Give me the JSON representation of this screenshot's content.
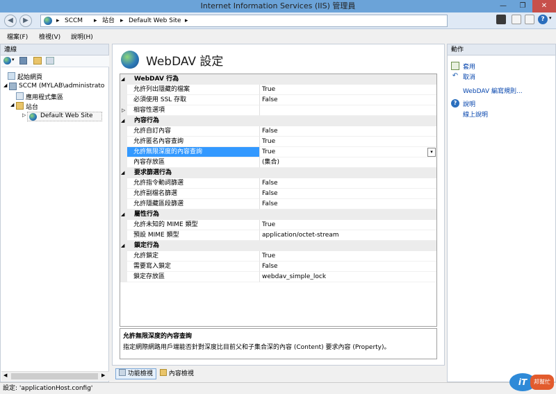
{
  "window": {
    "title": "Internet Information Services (IIS) 管理員"
  },
  "address": {
    "crumbs": [
      "SCCM",
      "站台",
      "Default Web Site"
    ]
  },
  "menu": {
    "file": "檔案(F)",
    "view": "檢視(V)",
    "help": "說明(H)"
  },
  "connections": {
    "title": "連線",
    "tree": {
      "start": "起始網頁",
      "server": "SCCM (MYLAB\\administrato",
      "app_pools": "應用程式集區",
      "sites": "站台",
      "default_site": "Default Web Site"
    }
  },
  "main": {
    "title": "WebDAV 設定",
    "categories": {
      "webdav": "WebDAV 行為",
      "content": "內容行為",
      "request": "要求篩選行為",
      "property": "屬性行為",
      "lock": "鎖定行為"
    },
    "rows": {
      "hidden_files": {
        "name": "允許列出隱藏的檔案",
        "value": "True"
      },
      "ssl": {
        "name": "必須使用 SSL 存取",
        "value": "False"
      },
      "compat": {
        "name": "相容性選項",
        "value": ""
      },
      "custom_props": {
        "name": "允許自訂內容",
        "value": "False"
      },
      "anon_query": {
        "name": "允許匿名內容查詢",
        "value": "True"
      },
      "infinite_query": {
        "name": "允許無限深度的內容查詢",
        "value": "True"
      },
      "store": {
        "name": "內容存放區",
        "value": "(集合)"
      },
      "cmd_filter": {
        "name": "允許指令動詞篩選",
        "value": "False"
      },
      "ext_filter": {
        "name": "允許副檔名篩選",
        "value": "False"
      },
      "hidden_seg": {
        "name": "允許隱藏區段篩選",
        "value": "False"
      },
      "unknown_mime": {
        "name": "允許未知的 MIME 類型",
        "value": "True"
      },
      "default_mime": {
        "name": "預設 MIME 類型",
        "value": "application/octet-stream"
      },
      "allow_lock": {
        "name": "允許鎖定",
        "value": "True"
      },
      "require_lock": {
        "name": "需要寫入鎖定",
        "value": "False"
      },
      "lock_store": {
        "name": "鎖定存放區",
        "value": "webdav_simple_lock"
      }
    },
    "description": {
      "title": "允許無限深度的內容查詢",
      "text": "指定網際網路用戶端能否針對深度比目前父和子集合深的內容 (Content) 要求內容 (Property)。"
    },
    "tabs": {
      "features": "功能檢視",
      "content": "內容檢視"
    }
  },
  "actions": {
    "title": "動作",
    "apply": "套用",
    "cancel": "取消",
    "rules": "WebDAV 編寫規則...",
    "help": "說明",
    "online_help": "線上說明"
  },
  "status": {
    "text": "設定: 'applicationHost.config'"
  },
  "watermark": {
    "text": "iT邦幫忙"
  }
}
